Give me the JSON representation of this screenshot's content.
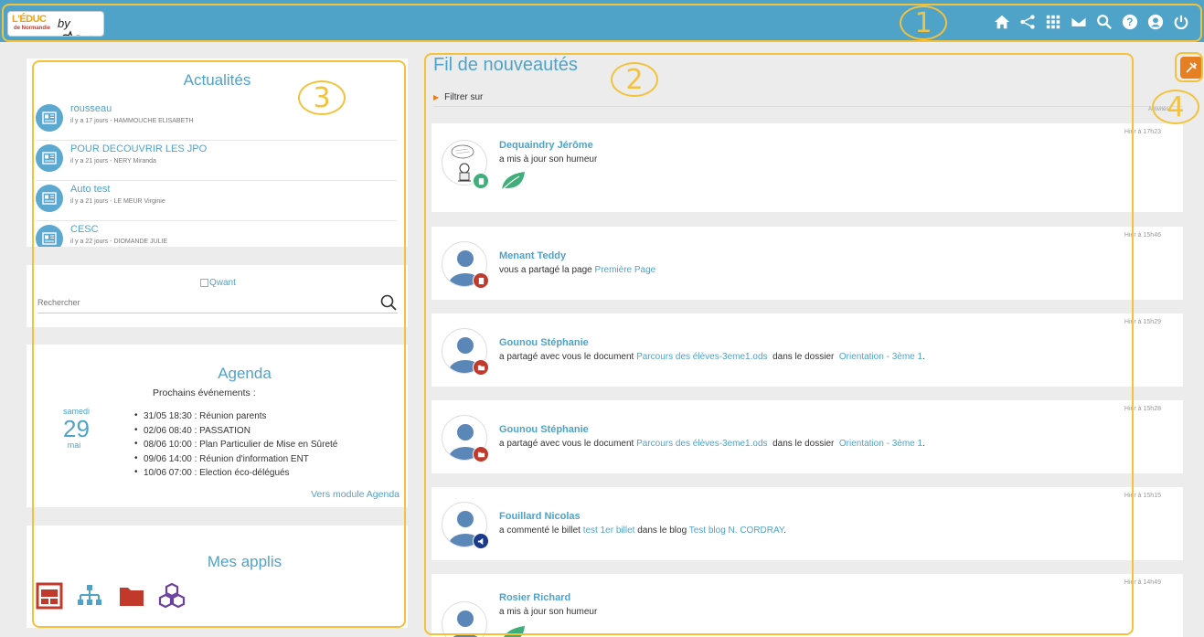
{
  "header": {
    "logo_main": "L'ÉDUC",
    "logo_sub": "de Normandie",
    "logo_by": "by",
    "icons": [
      "home-icon",
      "share-icon",
      "apps-grid-icon",
      "mail-icon",
      "search-icon",
      "help-icon",
      "user-icon",
      "power-icon"
    ]
  },
  "annotations": [
    "1",
    "2",
    "3",
    "4"
  ],
  "news": {
    "title": "Actualités",
    "items": [
      {
        "title": "rousseau",
        "meta": "il y a 17 jours - HAMMOUCHE ELISABETH"
      },
      {
        "title": "POUR DECOUVRIR LES JPO",
        "meta": "il y a 21 jours - NERY Miranda"
      },
      {
        "title": "Auto test",
        "meta": "il y a 21 jours - LE MEUR Virginie"
      },
      {
        "title": "CESC",
        "meta": "il y a 22 jours - DIOMANDE JULIE"
      }
    ]
  },
  "search": {
    "logo_alt": "Qwant",
    "placeholder": "Rechercher"
  },
  "agenda": {
    "title": "Agenda",
    "subtitle": "Prochains événements :",
    "day_name": "samedi",
    "day_num": "29",
    "month": "mai",
    "events": [
      "31/05 18:30 : Réunion parents",
      "02/06 08:40 : PASSATION",
      "08/06 10:00 : Plan Particulier de Mise en Sûreté",
      "09/06 14:00 : Réunion d'information ENT",
      "10/06 07:00 : Election éco-délégués"
    ],
    "link": "Vers module Agenda"
  },
  "apps": {
    "title": "Mes applis",
    "icons": [
      "calendar-app-icon",
      "sitemap-app-icon",
      "folder-app-icon",
      "cubes-app-icon"
    ],
    "colors": [
      "#c0392b",
      "#4fa3c9",
      "#c0392b",
      "#6b3fa0"
    ]
  },
  "feed": {
    "title": "Fil de nouveautés",
    "filter": "Filtrer sur",
    "activities_label": "Activités",
    "items": [
      {
        "name": "Dequaindry Jérôme",
        "text": "a mis à jour son humeur",
        "date": "Hier à 17h23"
      },
      {
        "name": "Menant Teddy",
        "pre": "vous a partagé la page ",
        "link1": "Première Page",
        "date": "Hier à 15h46"
      },
      {
        "name": "Gounou Stéphanie",
        "pre": "a partagé avec vous le document ",
        "link1": "Parcours des élèves-3eme1.ods",
        "mid": "  dans le dossier  ",
        "link2": "Orientation - 3ème 1",
        "post": ".",
        "date": "Hier à 15h29"
      },
      {
        "name": "Gounou Stéphanie",
        "pre": "a partagé avec vous le document ",
        "link1": "Parcours des élèves-3eme1.ods",
        "mid": "  dans le dossier  ",
        "link2": "Orientation - 3ème 1",
        "post": ".",
        "date": "Hier à 15h28"
      },
      {
        "name": "Fouillard Nicolas",
        "pre": "a commenté le billet ",
        "link1": "test 1er billet",
        "mid": " dans le blog ",
        "link2": "Test blog N. CORDRAY",
        "post": ".",
        "date": "Hier à 15h15"
      },
      {
        "name": "Rosier Richard",
        "text": "a mis à jour son humeur",
        "date": "Hier à 14h49"
      }
    ]
  },
  "colors": {
    "topbar": "#4fa3c9",
    "accent": "#4fa3c9",
    "annotation": "#f3c23a",
    "tool": "#e67e22"
  }
}
